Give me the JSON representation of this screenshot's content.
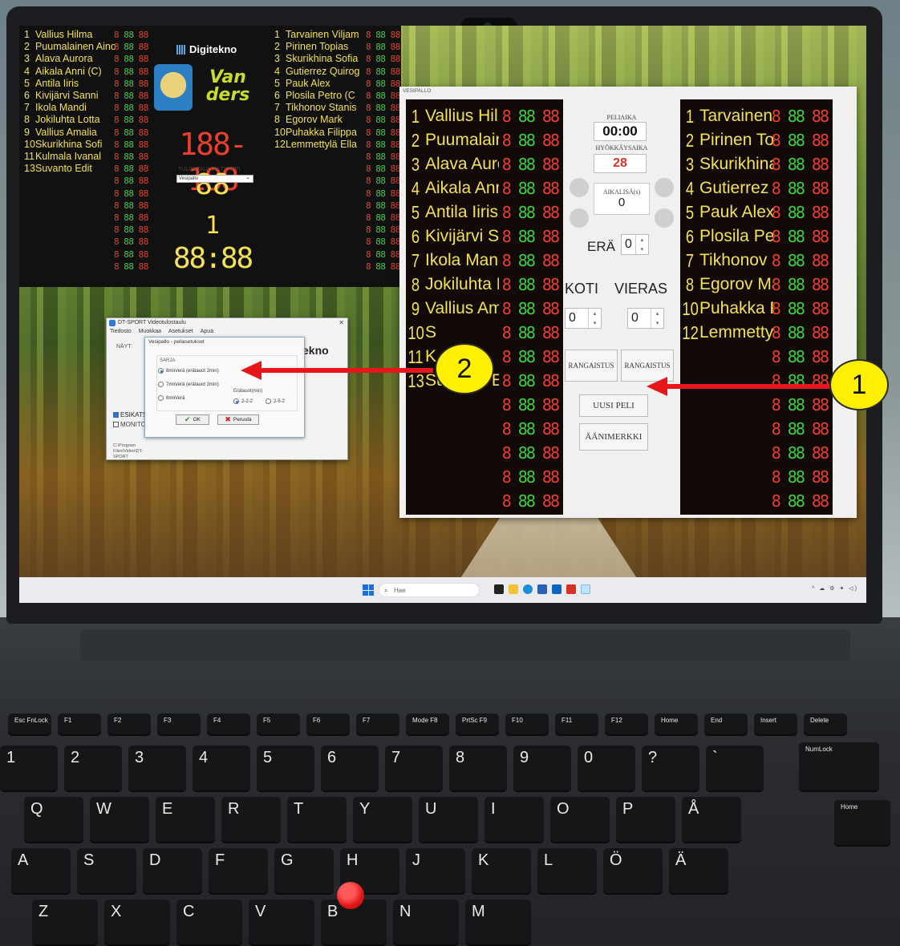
{
  "home_players": [
    {
      "num": "1",
      "name": "Vallius Hilma"
    },
    {
      "num": "2",
      "name": "Puumalainen Aino"
    },
    {
      "num": "3",
      "name": "Alava Aurora"
    },
    {
      "num": "4",
      "name": "Aikala Anni (C)"
    },
    {
      "num": "5",
      "name": "Antila Iiris"
    },
    {
      "num": "6",
      "name": "Kivijärvi Sanni"
    },
    {
      "num": "7",
      "name": "Ikola Mandi"
    },
    {
      "num": "8",
      "name": "Jokiluhta Lotta"
    },
    {
      "num": "9",
      "name": "Vallius Amalia"
    },
    {
      "num": "10",
      "name": "Skurikhina Sofi"
    },
    {
      "num": "11",
      "name": "Kulmala Ivanal"
    },
    {
      "num": "13",
      "name": "Suvanto Edit"
    }
  ],
  "away_players": [
    {
      "num": "1",
      "name": "Tarvainen Viljam"
    },
    {
      "num": "2",
      "name": "Pirinen Topias"
    },
    {
      "num": "3",
      "name": "Skurikhina Sofia"
    },
    {
      "num": "4",
      "name": "Gutierrez Quirog"
    },
    {
      "num": "5",
      "name": "Pauk Alex"
    },
    {
      "num": "6",
      "name": "Plosila Petro (C"
    },
    {
      "num": "7",
      "name": "Tikhonov Stanis"
    },
    {
      "num": "8",
      "name": "Egorov Mark"
    },
    {
      "num": "10",
      "name": "Puhakka Filippa"
    },
    {
      "num": "12",
      "name": "Lemmettylä Ella"
    }
  ],
  "control_home": [
    {
      "num": "1",
      "name": "Vallius Hilm"
    },
    {
      "num": "2",
      "name": "Puumalain"
    },
    {
      "num": "3",
      "name": "Alava Auroi"
    },
    {
      "num": "4",
      "name": "Aikala Anni"
    },
    {
      "num": "5",
      "name": "Antila Iiris"
    },
    {
      "num": "6",
      "name": "Kivijärvi Sa"
    },
    {
      "num": "7",
      "name": "Ikola Mandi"
    },
    {
      "num": "8",
      "name": "Jokiluhta L"
    },
    {
      "num": "9",
      "name": "Vallius Ama"
    },
    {
      "num": "10",
      "name": "S"
    },
    {
      "num": "11",
      "name": "K"
    },
    {
      "num": "13",
      "name": "Suvanto Ed"
    }
  ],
  "control_away": [
    {
      "num": "1",
      "name": "Tarvainen \\"
    },
    {
      "num": "2",
      "name": "Pirinen To"
    },
    {
      "num": "3",
      "name": "Skurikhina"
    },
    {
      "num": "4",
      "name": "Gutierrez ("
    },
    {
      "num": "5",
      "name": "Pauk Alex"
    },
    {
      "num": "6",
      "name": "Plosila Pet"
    },
    {
      "num": "7",
      "name": "Tikhonov St"
    },
    {
      "num": "8",
      "name": "Egorov Ma"
    },
    {
      "num": "10",
      "name": "Puhakka Fil"
    },
    {
      "num": "12",
      "name": "Lemmettylä"
    }
  ],
  "seg_digits": "8 88 88",
  "big_board": {
    "brand": "Digitekno",
    "team_logo_text": "Van ders",
    "score": "188-188",
    "shot_clock": "88",
    "period": "1",
    "game_clock": "88:88"
  },
  "dt_window": {
    "title": "DT-SPORT Videotulostaulu",
    "menu": [
      "Tiedosto",
      "Muokkaa",
      "Asetukset",
      "Apua"
    ],
    "label_nae": "NÄYT",
    "ekno": "ekno",
    "chk_esikatselu": "ESIKATSE",
    "chk_monitori": "MONITO",
    "path": "C:\\Program Files\\Video\\DT-SPORT",
    "type_label": "TULOSTAULUN TYYPPI",
    "type_value": "Vesipallo"
  },
  "dialog": {
    "title": "Vesipallo - peliasetukset",
    "group_label": "SARJA",
    "radio1": "8min/erä (erätauot 2min)",
    "radio2": "7min/erä (erätauot 2min)",
    "radio3": "8min/erä",
    "eratauot_label": "Erätauot(min)",
    "opt_222": "2-2-2",
    "opt_252": "2-5-2",
    "ok": "OK",
    "cancel": "Peruuta"
  },
  "control": {
    "title": "VESIPALLO",
    "peliaika_label": "PELIAIKA",
    "peliaika": "00:00",
    "hyokkaysaika_label": "HYÖKKÄYSAIKA",
    "hyokkaysaika": "28",
    "aikalisa_label": "AIKALISÄ(s)",
    "aikalisa": "0",
    "era_label": "ERÄ",
    "era": "0",
    "koti_label": "KOTI",
    "vieras_label": "VIERAS",
    "koti": "0",
    "vieras": "0",
    "rangaistus_home": "RANGAISTUS",
    "rangaistus_away": "RANGAISTUS",
    "uusi_peli": "UUSI PELI",
    "aanimerkki": "ÄÄNIMERKKI"
  },
  "taskbar": {
    "search_placeholder": "Hae"
  },
  "callouts": {
    "one": "1",
    "two": "2"
  },
  "colors": {
    "callout_fill": "#ffef00",
    "arrow": "#e8161b",
    "segment_green": "#3ecf3e",
    "segment_red": "#e8402c",
    "board_text": "#f3e15a"
  },
  "keyboard": {
    "fn_row": [
      "Esc FnLock",
      "F1",
      "F2",
      "F3",
      "F4",
      "F5",
      "F6",
      "F7",
      "Mode F8",
      "PrtSc F9",
      "F10",
      "F11",
      "F12",
      "Home",
      "End",
      "Insert",
      "Delete"
    ],
    "num_row": [
      "1",
      "2",
      "3",
      "4",
      "5",
      "6",
      "7",
      "8",
      "9",
      "0",
      "?",
      "`"
    ],
    "row_q": [
      "Q",
      "W",
      "E",
      "R",
      "T",
      "Y",
      "U",
      "I",
      "O",
      "P",
      "Å"
    ],
    "row_a": [
      "A",
      "S",
      "D",
      "F",
      "G",
      "H",
      "J",
      "K",
      "L",
      "Ö",
      "Ä"
    ],
    "row_z": [
      "Z",
      "X",
      "C",
      "V",
      "B",
      "N",
      "M"
    ],
    "numlock": "NumLock",
    "home": "Home"
  }
}
